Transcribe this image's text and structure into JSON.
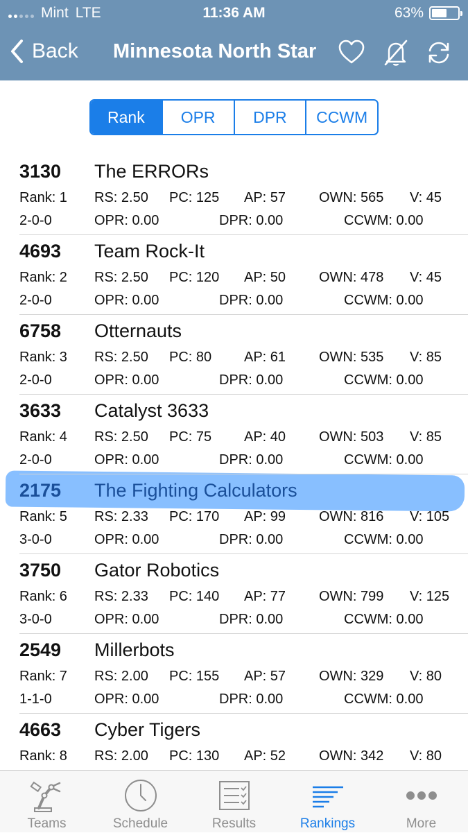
{
  "status": {
    "carrier": "Mint",
    "network": "LTE",
    "time": "11:36 AM",
    "battery": "63%",
    "battery_level": 0.63
  },
  "nav": {
    "back_label": "Back",
    "title": "Minnesota North Star"
  },
  "segments": [
    "Rank",
    "OPR",
    "DPR",
    "CCWM"
  ],
  "teams": [
    {
      "number": "3130",
      "name": "The ERRORs",
      "rank": "Rank: 1",
      "rs": "RS: 2.50",
      "pc": "PC: 125",
      "ap": "AP: 57",
      "own": "OWN: 565",
      "v": "V: 45",
      "record": "2-0-0",
      "opr": "OPR: 0.00",
      "dpr": "DPR: 0.00",
      "ccwm": "CCWM: 0.00"
    },
    {
      "number": "4693",
      "name": "Team Rock-It",
      "rank": "Rank: 2",
      "rs": "RS: 2.50",
      "pc": "PC: 120",
      "ap": "AP: 50",
      "own": "OWN: 478",
      "v": "V: 45",
      "record": "2-0-0",
      "opr": "OPR: 0.00",
      "dpr": "DPR: 0.00",
      "ccwm": "CCWM: 0.00"
    },
    {
      "number": "6758",
      "name": "Otternauts",
      "rank": "Rank: 3",
      "rs": "RS: 2.50",
      "pc": "PC: 80",
      "ap": "AP: 61",
      "own": "OWN: 535",
      "v": "V: 85",
      "record": "2-0-0",
      "opr": "OPR: 0.00",
      "dpr": "DPR: 0.00",
      "ccwm": "CCWM: 0.00"
    },
    {
      "number": "3633",
      "name": "Catalyst 3633",
      "rank": "Rank: 4",
      "rs": "RS: 2.50",
      "pc": "PC: 75",
      "ap": "AP: 40",
      "own": "OWN: 503",
      "v": "V: 85",
      "record": "2-0-0",
      "opr": "OPR: 0.00",
      "dpr": "DPR: 0.00",
      "ccwm": "CCWM: 0.00"
    },
    {
      "number": "2175",
      "name": "The Fighting Calculators",
      "rank": "Rank: 5",
      "rs": "RS: 2.33",
      "pc": "PC: 170",
      "ap": "AP: 99",
      "own": "OWN: 816",
      "v": "V: 105",
      "record": "3-0-0",
      "opr": "OPR: 0.00",
      "dpr": "DPR: 0.00",
      "ccwm": "CCWM: 0.00"
    },
    {
      "number": "3750",
      "name": "Gator Robotics",
      "rank": "Rank: 6",
      "rs": "RS: 2.33",
      "pc": "PC: 140",
      "ap": "AP: 77",
      "own": "OWN: 799",
      "v": "V: 125",
      "record": "3-0-0",
      "opr": "OPR: 0.00",
      "dpr": "DPR: 0.00",
      "ccwm": "CCWM: 0.00"
    },
    {
      "number": "2549",
      "name": "Millerbots",
      "rank": "Rank: 7",
      "rs": "RS: 2.00",
      "pc": "PC: 155",
      "ap": "AP: 57",
      "own": "OWN: 329",
      "v": "V: 80",
      "record": "1-1-0",
      "opr": "OPR: 0.00",
      "dpr": "DPR: 0.00",
      "ccwm": "CCWM: 0.00"
    },
    {
      "number": "4663",
      "name": "Cyber Tigers",
      "rank": "Rank: 8",
      "rs": "RS: 2.00",
      "pc": "PC: 130",
      "ap": "AP: 52",
      "own": "OWN: 342",
      "v": "V: 80",
      "record": "",
      "opr": "",
      "dpr": "",
      "ccwm": ""
    }
  ],
  "tabs": [
    {
      "label": "Teams",
      "icon": "robot-arm-icon"
    },
    {
      "label": "Schedule",
      "icon": "clock-icon"
    },
    {
      "label": "Results",
      "icon": "checklist-icon"
    },
    {
      "label": "Rankings",
      "icon": "rankings-icon"
    },
    {
      "label": "More",
      "icon": "more-dots-icon"
    }
  ],
  "colors": {
    "nav_bg": "#6d93b5",
    "accent": "#1b7ee8",
    "highlight": "#5aa6ff"
  }
}
